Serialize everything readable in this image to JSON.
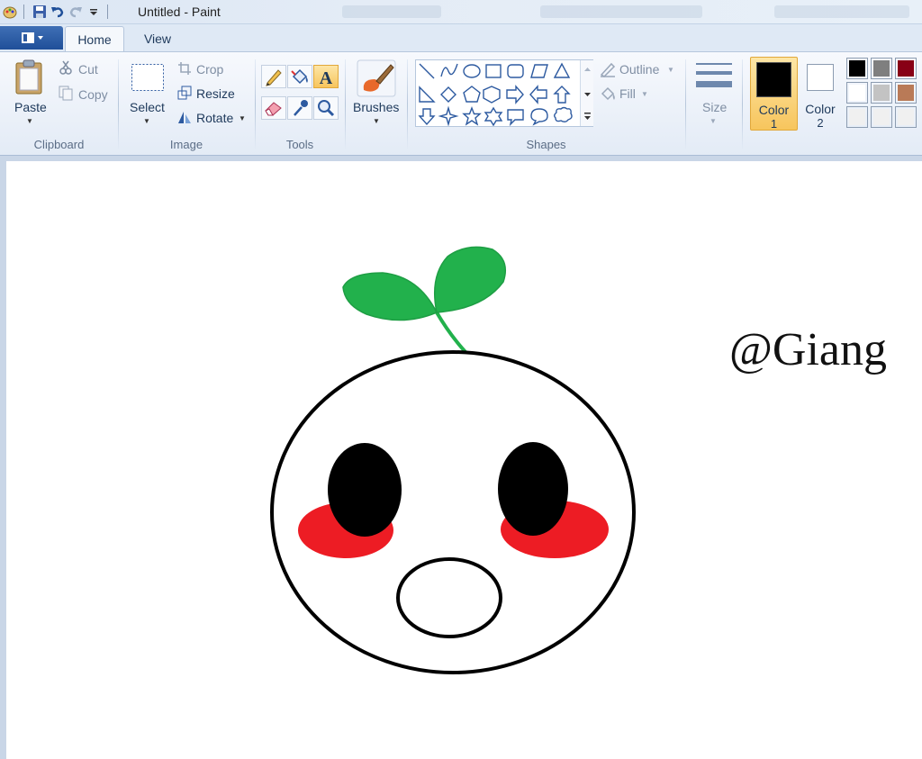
{
  "window": {
    "title": "Untitled - Paint"
  },
  "tabs": [
    {
      "label": "Home",
      "active": true
    },
    {
      "label": "View",
      "active": false
    }
  ],
  "ribbon": {
    "clipboard": {
      "group_label": "Clipboard",
      "paste": "Paste",
      "cut": "Cut",
      "copy": "Copy"
    },
    "image": {
      "group_label": "Image",
      "select": "Select",
      "crop": "Crop",
      "resize": "Resize",
      "rotate": "Rotate"
    },
    "tools": {
      "group_label": "Tools"
    },
    "brushes": {
      "label": "Brushes"
    },
    "shapes": {
      "group_label": "Shapes",
      "outline": "Outline",
      "fill": "Fill"
    },
    "size": {
      "label": "Size"
    },
    "colors": {
      "color1_label_line1": "Color",
      "color1_label_line2": "1",
      "color2_label_line1": "Color",
      "color2_label_line2": "2",
      "color1": "#000000",
      "color2": "#ffffff",
      "palette_row1": [
        "#000000",
        "#7f7f7f",
        "#880015"
      ],
      "palette_row2": [
        "#ffffff",
        "#c3c3c3",
        "#b97a57"
      ],
      "palette_row3": [
        "#f0f0f0",
        "#f0f0f0",
        "#f0f0f0"
      ]
    }
  },
  "canvas": {
    "text": "@Giang",
    "colors": {
      "leaf": "#22b14c",
      "cheek": "#ed1c24",
      "ink": "#000000"
    }
  }
}
